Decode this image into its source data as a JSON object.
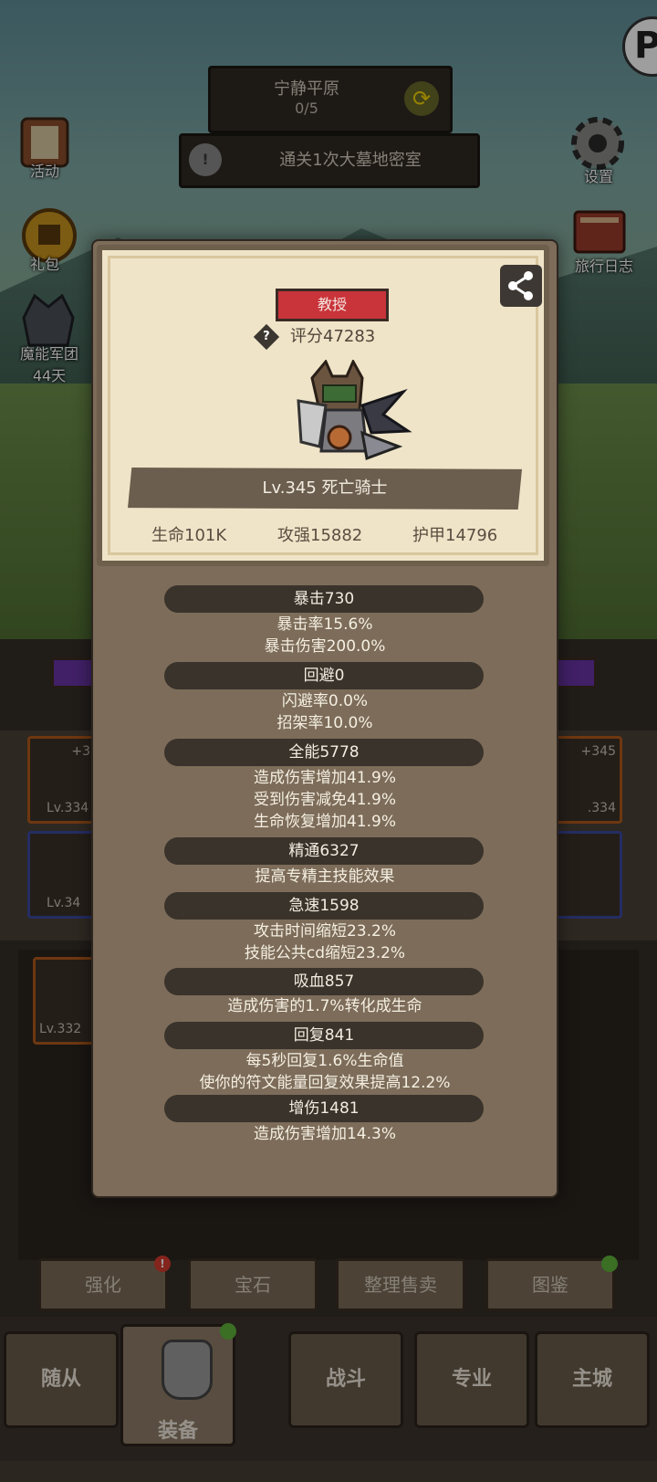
{
  "hud": {
    "zone_name": "宁静平原",
    "zone_progress": "0/5",
    "quest_text": "通关1次大墓地密室",
    "left_icons": [
      {
        "label": "活动",
        "icon": "scroll-icon"
      },
      {
        "label": "礼包",
        "icon": "gift-coin-icon"
      },
      {
        "label": "魔能军团",
        "sub": "44天",
        "icon": "legion-helmet-icon"
      }
    ],
    "right_icons": [
      {
        "label": "设置",
        "icon": "gear-icon"
      },
      {
        "label": "旅行日志",
        "icon": "journal-icon"
      }
    ]
  },
  "modal": {
    "rank_badge": "教授",
    "score": "评分47283",
    "hero_name": "Lv.345 死亡骑士",
    "base_stats": [
      "生命101K",
      "攻强15882",
      "护甲14796"
    ],
    "stat_groups": [
      {
        "title": "暴击730",
        "lines": [
          "暴击率15.6%",
          "暴击伤害200.0%"
        ]
      },
      {
        "title": "回避0",
        "lines": [
          "闪避率0.0%",
          "招架率10.0%"
        ]
      },
      {
        "title": "全能5778",
        "lines": [
          "造成伤害增加41.9%",
          "受到伤害减免41.9%",
          "生命恢复增加41.9%"
        ]
      },
      {
        "title": "精通6327",
        "lines": [
          "提高专精主技能效果"
        ]
      },
      {
        "title": "急速1598",
        "lines": [
          "攻击时间缩短23.2%",
          "技能公共cd缩短23.2%"
        ]
      },
      {
        "title": "吸血857",
        "lines": [
          "造成伤害的1.7%转化成生命"
        ]
      },
      {
        "title": "回复841",
        "lines": [
          "每5秒回复1.6%生命值",
          "使你的符文能量回复效果提高12.2%"
        ]
      },
      {
        "title": "增伤1481",
        "lines": [
          "造成伤害增加14.3%"
        ]
      }
    ]
  },
  "background_slots": [
    {
      "level": "Lv.334",
      "plus": "+3"
    },
    {
      "level": "Lv.34",
      "plus": ""
    },
    {
      "level": "Lv.332",
      "plus": ""
    },
    {
      "level": ".334",
      "plus": "+345"
    }
  ],
  "actions": [
    {
      "label": "强化",
      "badge": "!"
    },
    {
      "label": "宝石",
      "badge": ""
    },
    {
      "label": "整理售卖",
      "badge": ""
    },
    {
      "label": "图鉴",
      "badge": " "
    }
  ],
  "nav": [
    "随从",
    "装备",
    "战斗",
    "专业",
    "主城"
  ],
  "colors": {
    "rank_red": "#c8343a",
    "card_bg": "#efe4c8",
    "modal_bg": "#7c6c59",
    "pill_bg": "#3a332c",
    "alert_red": "#d33b2f",
    "badge_green": "#5fb33a"
  }
}
